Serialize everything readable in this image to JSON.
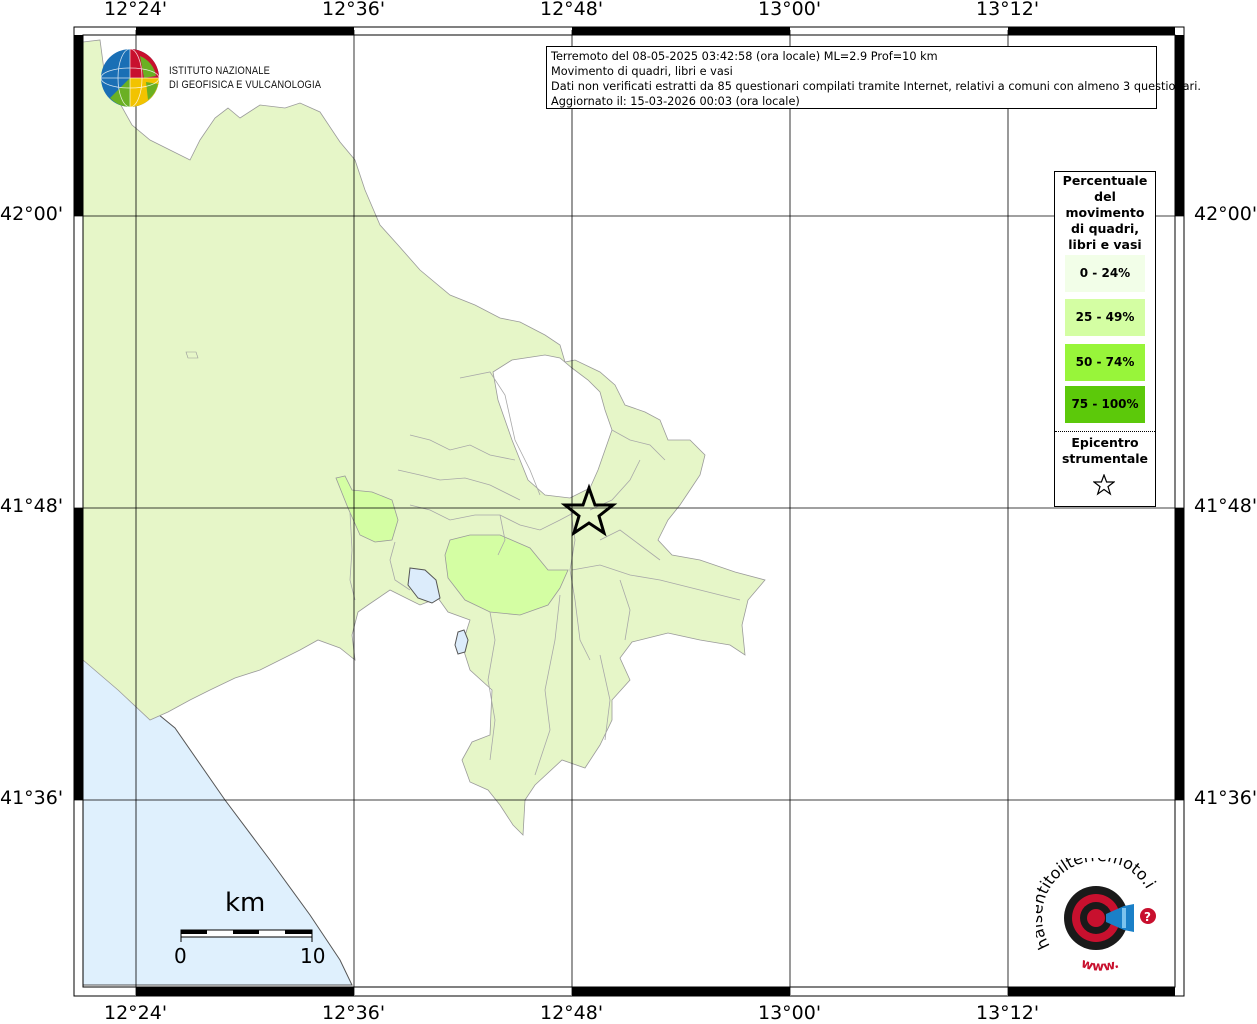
{
  "header": {
    "line1": "Terremoto del 08-05-2025 03:42:58 (ora locale) ML=2.9 Prof=10 km",
    "line2": "Movimento di quadri, libri e vasi",
    "line3": "Dati non verificati estratti da 85 questionari compilati tramite Internet, relativi a comuni con almeno 3 questionari.",
    "line4": "Aggiornato il: 15-03-2026 00:03 (ora locale)"
  },
  "axes": {
    "lon_ticks": [
      "12°24'",
      "12°36'",
      "12°48'",
      "13°00'",
      "13°12'"
    ],
    "lat_ticks": [
      "42°00'",
      "41°48'",
      "41°36'"
    ]
  },
  "legend": {
    "title_lines": [
      "Percentuale",
      "del",
      "movimento",
      "di quadri,",
      "libri e vasi"
    ],
    "classes": [
      {
        "label": "0 - 24%",
        "color": "#f2fee8"
      },
      {
        "label": "25 - 49%",
        "color": "#d4fea3"
      },
      {
        "label": "50 - 74%",
        "color": "#98f53a"
      },
      {
        "label": "75 - 100%",
        "color": "#5cc90a"
      }
    ],
    "epicenter_lines": [
      "Epicentro",
      "strumentale"
    ]
  },
  "logo": {
    "ingv_line1": "ISTITUTO NAZIONALE",
    "ingv_line2": "DI GEOFISICA E VULCANOLOGIA",
    "hai_text": "haisentitoilterremoto.it",
    "hai_www": "www."
  },
  "scale": {
    "unit": "km",
    "start": "0",
    "end": "10"
  },
  "colors": {
    "land_fill": "#d9f0ae",
    "comune_low": "#f2fee8",
    "comune_mid": "#d4fea3",
    "sea": "#dff0fd",
    "lake": "#dcecfb"
  }
}
